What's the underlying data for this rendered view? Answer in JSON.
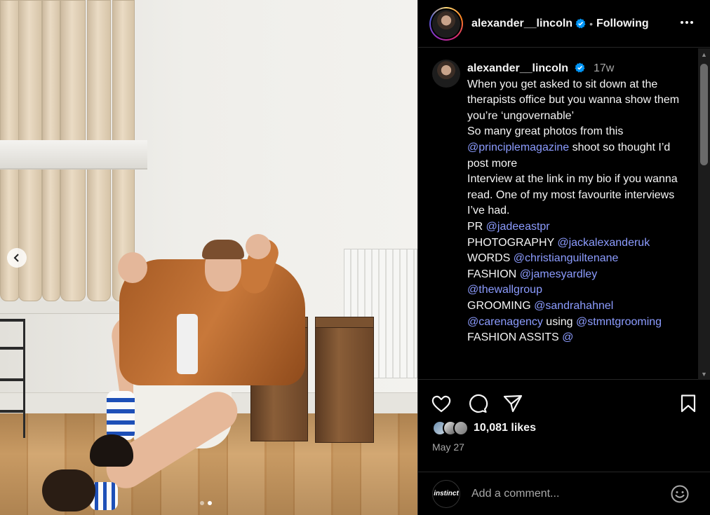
{
  "post": {
    "username": "alexander__lincoln",
    "separator": "•",
    "follow_status": "Following",
    "time_ago": "17w",
    "caption": {
      "line1": "When you get asked to sit down at the therapists office but you wanna show them you’re ‘ungovernable’",
      "line2a": "So many great photos from this ",
      "line2_mention": "@principlemagazine",
      "line2b": " shoot so thought I’d post more",
      "line3": "Interview at the link in my bio if you wanna read. One of my most favourite interviews I’ve had.",
      "credits": [
        {
          "role": "PR ",
          "mentions": [
            "@jadeeastpr"
          ]
        },
        {
          "role": "PHOTOGRAPHY ",
          "mentions": [
            "@jackalexanderuk"
          ]
        },
        {
          "role": "WORDS ",
          "mentions": [
            "@christianguiltenane"
          ]
        },
        {
          "role": "FASHION ",
          "mentions": [
            "@jamesyardley",
            "@thewallgroup"
          ]
        },
        {
          "role": "GROOMING ",
          "mentions": [
            "@sandrahahnel",
            "@carenagency"
          ],
          "suffix": " using ",
          "extra": "@stmntgrooming"
        },
        {
          "role": "FASHION ASSITS ",
          "mentions": [
            "@"
          ]
        }
      ]
    },
    "likes": "10,081 likes",
    "date": "May 27",
    "comment_placeholder": "Add a comment...",
    "commenter_avatar_text": "instinct"
  },
  "icons": {
    "verified": "verified-badge-icon",
    "like": "heart-icon",
    "comment": "comment-icon",
    "share": "send-icon",
    "save": "bookmark-icon",
    "more": "more-icon",
    "emoji": "emoji-icon",
    "prev": "chevron-left-icon"
  },
  "carousel": {
    "total": 2,
    "active": 2
  },
  "colors": {
    "mention": "#8c9cff",
    "verified": "#0095f6",
    "background": "#000000"
  }
}
